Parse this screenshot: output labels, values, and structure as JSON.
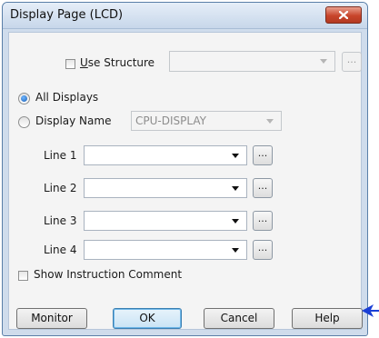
{
  "window": {
    "title": "Display Page (LCD)"
  },
  "use_structure": {
    "label": "Use Structure",
    "checked": false,
    "value": "",
    "ellipsis": "..."
  },
  "display_mode": {
    "all_displays_label": "All Displays",
    "display_name_label": "Display Name",
    "selected": "All Displays",
    "display_name_value": "CPU-DISPLAY"
  },
  "lines": [
    {
      "label": "Line 1",
      "value": "",
      "ellipsis": "..."
    },
    {
      "label": "Line 2",
      "value": "",
      "ellipsis": "..."
    },
    {
      "label": "Line 3",
      "value": "",
      "ellipsis": "..."
    },
    {
      "label": "Line 4",
      "value": "",
      "ellipsis": "..."
    }
  ],
  "show_comment": {
    "label": "Show Instruction Comment",
    "checked": false
  },
  "buttons": {
    "monitor": "Monitor",
    "ok": "OK",
    "cancel": "Cancel",
    "help": "Help"
  },
  "colors": {
    "annotation_arrow": "#1a3fd6",
    "radio_selected": "#1a5fb4"
  },
  "icons": {
    "close": "close-x-icon",
    "dropdown": "chevron-down-icon",
    "annotation": "arrow-left-icon"
  }
}
